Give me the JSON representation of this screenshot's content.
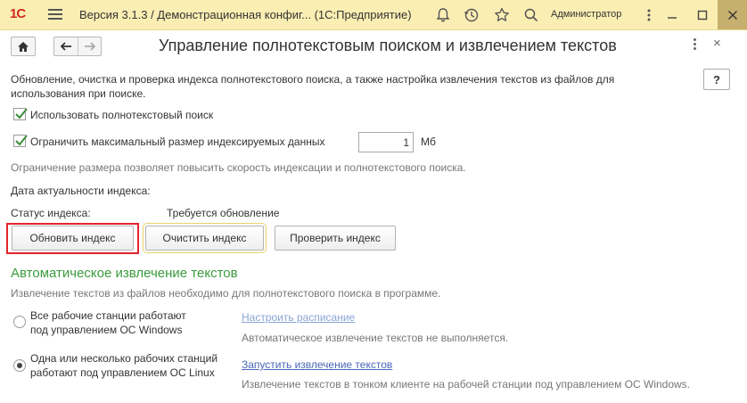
{
  "window": {
    "logo": "1С",
    "title": "Версия 3.1.3 / Демонстрационная конфиг... (1С:Предприятие)",
    "user": "Администратор"
  },
  "form": {
    "title": "Управление полнотекстовым поиском и извлечением текстов",
    "help_label": "?",
    "description": "Обновление, очистка и проверка индекса полнотекстового поиска, а также настройка извлечения текстов из файлов для использования при поиске.",
    "use_fulltext": {
      "label": "Использовать полнотекстовый поиск",
      "checked": true
    },
    "limit_size": {
      "label": "Ограничить максимальный размер индексируемых данных",
      "checked": true,
      "value": "1",
      "unit": "Мб"
    },
    "limit_hint": "Ограничение размера позволяет повысить скорость индексации и полнотекстового поиска.",
    "index_date_label": "Дата актуальности индекса:",
    "status_label": "Статус индекса:",
    "status_value": "Требуется обновление",
    "buttons": {
      "update": "Обновить индекс",
      "clear": "Очистить индекс",
      "check": "Проверить индекс"
    }
  },
  "extraction": {
    "title": "Автоматическое извлечение текстов",
    "hint": "Извлечение текстов из файлов необходимо для полнотекстового поиска в программе.",
    "option_windows": {
      "label_line1": "Все рабочие станции работают",
      "label_line2": "под управлением ОС Windows",
      "selected": false,
      "link": "Настроить расписание",
      "note": "Автоматическое извлечение текстов не выполняется."
    },
    "option_linux": {
      "label_line1": "Одна или несколько рабочих станций",
      "label_line2": "работают под управлением ОС Linux",
      "selected": true,
      "link": "Запустить извлечение текстов",
      "note": "Извлечение текстов в тонком клиенте на рабочей станции под управлением ОС Windows."
    }
  },
  "colors": {
    "accent_title_bar": "#fbeeb3",
    "section_green": "#3b9b3b",
    "link_blue": "#4a67b9",
    "highlight_red": "#e3242b"
  }
}
